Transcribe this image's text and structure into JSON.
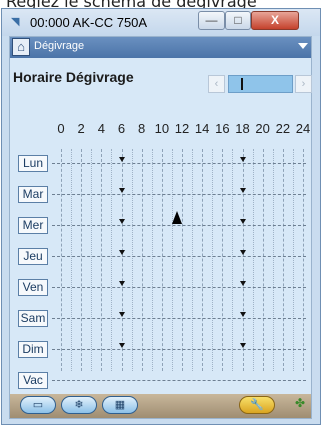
{
  "top_caption": "Réglez le schéma de dégivrage",
  "window": {
    "title": "00:000 AK-CC 750A",
    "buttons": {
      "minimize": "—",
      "maximize": "□",
      "close": "X"
    }
  },
  "breadcrumb": {
    "label": "Dégivrage"
  },
  "section": {
    "title": "Horaire Dégivrage",
    "prev_icon": "‹",
    "next_icon": "›"
  },
  "schedule": {
    "hour_labels": [
      "0",
      "2",
      "4",
      "6",
      "8",
      "10",
      "12",
      "14",
      "16",
      "18",
      "20",
      "22",
      "24"
    ],
    "days": [
      "Lun",
      "Mar",
      "Mer",
      "Jeu",
      "Ven",
      "Sam",
      "Dim",
      "Vac"
    ],
    "defrost_hours": [
      6,
      18
    ],
    "cursor_marker": {
      "day": "Mer",
      "hour": 11.5
    }
  },
  "toolbar": {
    "btn1_label": "▭",
    "btn2_label": "❄",
    "btn3_label": "▦",
    "wrench_label": "🔧"
  },
  "colors": {
    "titlebar": "#c9dcef",
    "crumb": "#5a82b6",
    "client": "#d7e8f7",
    "close": "#c4412c"
  }
}
